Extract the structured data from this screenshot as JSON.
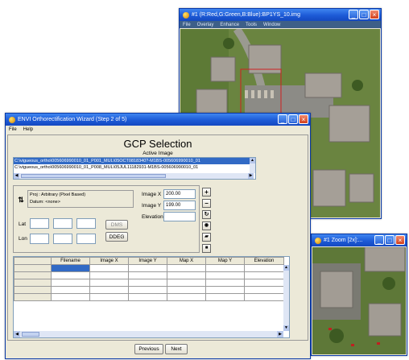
{
  "top_window": {
    "title": "#1 (R:Red,G:Green,B:Blue):BP1YS_10.img",
    "menu": [
      "File",
      "Overlay",
      "Enhance",
      "Tools",
      "Window"
    ]
  },
  "zoom_window": {
    "title": "#1 Zoom [2x]:..."
  },
  "wizard": {
    "title": "ENVI Orthorectification Wizard (Step 2 of 5)",
    "menu": [
      "File",
      "Help"
    ],
    "heading": "GCP Selection",
    "active_image_label": "Active Image",
    "image_list": [
      "C:\\vigueous_ortho\\005606990010_01_P001_MUL\\05OCT0818340?-M1BS-005606990010_01",
      "C:\\vigueous_ortho\\005606990010_01_P008_MUL\\05JUL11182931-M1BS-005606990010_01"
    ],
    "proj_label": "Proj : Arbitrary (Pixel Based)",
    "datum_label": "Datum: <none>",
    "image_x_label": "Image X",
    "image_x_value": "200.00",
    "image_y_label": "Image Y",
    "image_y_value": "199.00",
    "elevation_label": "Elevation",
    "lat_label": "Lat",
    "lon_label": "Lon",
    "dms_label": "DMS",
    "ddeg_label": "DDEG",
    "table_headers": [
      "Filename",
      "Image X",
      "Image Y",
      "Map X",
      "Map Y",
      "Elevation"
    ],
    "previous_label": "Previous",
    "next_label": "Next"
  },
  "icons": [
    "swap-arrows-icon",
    "plus-icon",
    "minus-icon",
    "refresh-icon",
    "eye-icon",
    "open-folder-icon",
    "save-icon"
  ]
}
